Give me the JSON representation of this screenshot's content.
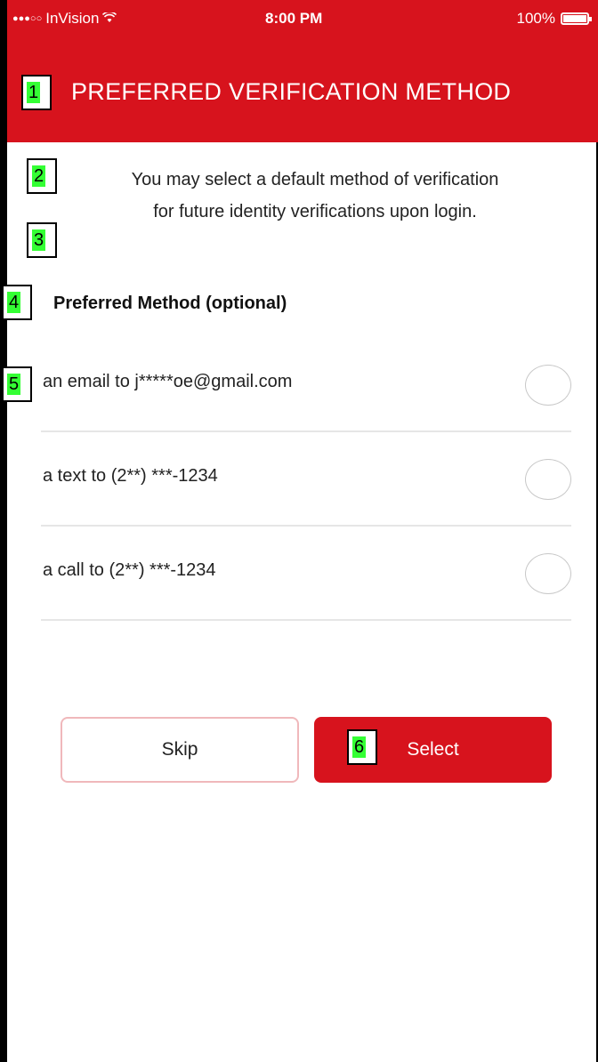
{
  "status_bar": {
    "carrier": "InVision",
    "time": "8:00 PM",
    "battery": "100%"
  },
  "header": {
    "title": "PREFERRED VERIFICATION METHOD"
  },
  "description": {
    "line1": "You may select a default method of verification",
    "line2": "for future identity verifications upon login."
  },
  "section_label": "Preferred Method (optional)",
  "options": [
    {
      "label": "an email to j*****oe@gmail.com"
    },
    {
      "label": "a text to (2**) ***-1234"
    },
    {
      "label": "a call to (2**) ***-1234"
    }
  ],
  "buttons": {
    "skip": "Skip",
    "select": "Select"
  },
  "markers": [
    "1",
    "2",
    "3",
    "4",
    "5",
    "6"
  ],
  "colors": {
    "brand_red": "#d7131d",
    "marker_green": "#34ff34"
  }
}
